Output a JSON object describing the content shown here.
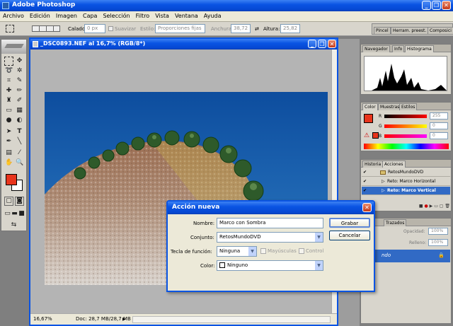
{
  "window": {
    "title": "Adobe Photoshop"
  },
  "menu": [
    "Archivo",
    "Edición",
    "Imagen",
    "Capa",
    "Selección",
    "Filtro",
    "Vista",
    "Ventana",
    "Ayuda"
  ],
  "options": {
    "calado_label": "Calado:",
    "calado_value": "0 px",
    "suavizar": "Suavizar",
    "estilo_label": "Estilo:",
    "estilo_value": "Proporciones fijas",
    "anchura_label": "Anchura:",
    "anchura_value": "38,72",
    "altura_label": "Altura:",
    "altura_value": "25,82"
  },
  "palette_well": {
    "tab1": "Pincel",
    "tab2": "Herram. preest.",
    "tab3": "Composici"
  },
  "document": {
    "title": "_DSC0893.NEF al 16,7% (RGB/8*)",
    "zoom": "16,67%",
    "status": "Doc: 28,7 MB/28,7 MB"
  },
  "navigator": {
    "tabs": [
      "Navegador",
      "Info",
      "Histograma"
    ]
  },
  "color_panel": {
    "tabs": [
      "Color",
      "Muestras",
      "Estilos"
    ],
    "r_label": "R",
    "r_value": "255",
    "g_label": "G",
    "g_value": "0",
    "b_label": "B",
    "b_value": "0",
    "foreground": "#e8341c"
  },
  "actions": {
    "tabs": [
      "Historia",
      "Acciones"
    ],
    "items": [
      "RetosMundoDVD",
      "Reto: Marco Horizontal",
      "Reto: Marco Vertical"
    ]
  },
  "layers": {
    "tabs": [
      "as",
      "Trazados"
    ],
    "opacity_label": "Opacidad:",
    "opacity_value": "100%",
    "fill_label": "Relleno:",
    "fill_value": "100%",
    "layer_name": "ndo"
  },
  "dialog": {
    "title": "Acción nueva",
    "nombre_label": "Nombre:",
    "nombre_value": "Marco con Sombra",
    "conjunto_label": "Conjunto:",
    "conjunto_value": "RetosMundoDVD",
    "tecla_label": "Tecla de función:",
    "tecla_value": "Ninguna",
    "mayus": "Mayúsculas",
    "control": "Control",
    "color_label": "Color:",
    "color_value": "Ninguno",
    "grabar": "Grabar",
    "cancelar": "Cancelar"
  }
}
